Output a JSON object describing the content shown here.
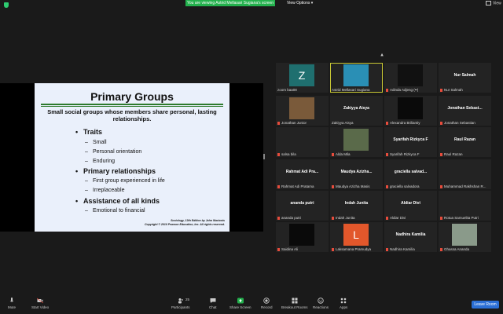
{
  "topbar": {
    "viewing_banner": "You are viewing Astrid Mellasari Sugiana's screen",
    "view_options": "View Options",
    "view_button": "View"
  },
  "slide": {
    "title": "Primary Groups",
    "subtitle": "Small social groups whose members share personal, lasting relationships.",
    "bullets": [
      {
        "text": "Traits",
        "subs": [
          "Small",
          "Personal orientation",
          "Enduring"
        ]
      },
      {
        "text": "Primary relationships",
        "subs": [
          "First group experienced in life",
          "Irreplaceable"
        ]
      },
      {
        "text": "Assistance of all kinds",
        "subs": [
          "Emotional to financial"
        ]
      }
    ],
    "credit_line1": "Sociology, 13th Edition by John Macionis",
    "credit_line2": "Copyright © 2010 Pearson Education, Inc.  All rights reserved."
  },
  "participants": [
    {
      "name": "zoom baa08",
      "tile_name": "",
      "letter": "Z",
      "avatar_color": "#1f6f6f",
      "muted": false
    },
    {
      "name": "Astrid Mellasari Sugiana",
      "tile_name": "",
      "letter": "",
      "avatar_color": "#2a8fb5",
      "muted": false,
      "active": true
    },
    {
      "name": "Adinda Adjeng (••)",
      "tile_name": "",
      "letter": "",
      "avatar_color": "#111111",
      "muted": true
    },
    {
      "name": "Nur Salmah",
      "tile_name": "Nur Salmah",
      "letter": "",
      "avatar_color": "",
      "muted": true
    },
    {
      "name": "Jonathan Junior",
      "tile_name": "",
      "letter": "",
      "avatar_color": "#7a5a3a",
      "muted": true
    },
    {
      "name": "Zakiyya Aisya",
      "tile_name": "Zakiyya Aisya",
      "letter": "",
      "avatar_color": "",
      "muted": false
    },
    {
      "name": "Alexandra Briliantiy",
      "tile_name": "",
      "letter": "",
      "avatar_color": "#0a0a0a",
      "muted": true
    },
    {
      "name": "Jonathan Sebastian",
      "tile_name": "Jonathan Sebast...",
      "letter": "",
      "avatar_color": "",
      "muted": true
    },
    {
      "name": "salsa bila",
      "tile_name": "",
      "letter": "",
      "avatar_color": "",
      "muted": true
    },
    {
      "name": "Alda Mila",
      "tile_name": "",
      "letter": "",
      "avatar_color": "#5a6a4a",
      "muted": true
    },
    {
      "name": "Syarifah Rizkyca F",
      "tile_name": "Syarifah Rizkyca F",
      "letter": "",
      "avatar_color": "",
      "muted": true
    },
    {
      "name": "Raul Razan",
      "tile_name": "Raul Razan",
      "letter": "",
      "avatar_color": "",
      "muted": true
    },
    {
      "name": "Rahmat Adi Pratama",
      "tile_name": "Rahmat Adi Pra...",
      "letter": "",
      "avatar_color": "",
      "muted": true
    },
    {
      "name": "Maudya Azizha Masis",
      "tile_name": "Maudya Azizha...",
      "letter": "",
      "avatar_color": "",
      "muted": true
    },
    {
      "name": "graciella salvadora",
      "tile_name": "graciella salvad...",
      "letter": "",
      "avatar_color": "",
      "muted": true
    },
    {
      "name": "Muhammad Rakhshan R...",
      "tile_name": "",
      "letter": "",
      "avatar_color": "",
      "muted": true
    },
    {
      "name": "ananda putri",
      "tile_name": "ananda putri",
      "letter": "",
      "avatar_color": "",
      "muted": true
    },
    {
      "name": "Indah Junita",
      "tile_name": "Indah Junita",
      "letter": "",
      "avatar_color": "",
      "muted": true
    },
    {
      "name": "Aldiar Divi",
      "tile_name": "Aldiar Divi",
      "letter": "",
      "avatar_color": "",
      "muted": true
    },
    {
      "name": "Rotua Samuelita Putri",
      "tile_name": "",
      "letter": "",
      "avatar_color": "",
      "muted": true
    },
    {
      "name": "Saidina Ali",
      "tile_name": "",
      "letter": "",
      "avatar_color": "#0a0a0a",
      "muted": true
    },
    {
      "name": "Laksamana Pramudya",
      "tile_name": "",
      "letter": "L",
      "avatar_color": "#e2572b",
      "muted": true
    },
    {
      "name": "Nadhira Kamilia",
      "tile_name": "Nadhira Kamilia",
      "letter": "",
      "avatar_color": "",
      "muted": true
    },
    {
      "name": "Ghassa Ananda",
      "tile_name": "",
      "letter": "",
      "avatar_color": "#8a9a8a",
      "muted": true
    }
  ],
  "toolbar": {
    "mute": "Mute",
    "start_video": "Start Video",
    "participants": "Participants",
    "participants_count": "25",
    "chat": "Chat",
    "share_screen": "Share Screen",
    "record": "Record",
    "breakout_rooms": "Breakout Rooms",
    "reactions": "Reactions",
    "apps": "Apps",
    "leave_room": "Leave Room"
  },
  "colors": {
    "share_green": "#23b14d",
    "leave_blue": "#2b6fd6",
    "active_speaker": "#c9c834",
    "muted_red": "#e74c3c"
  }
}
